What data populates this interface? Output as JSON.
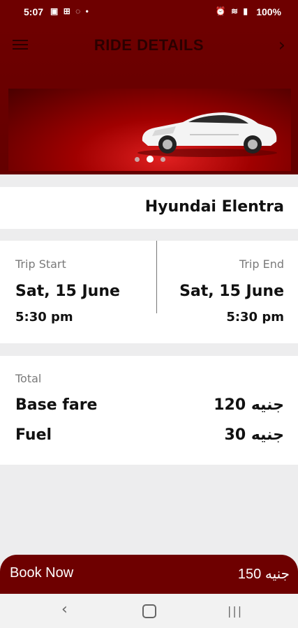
{
  "status_bar": {
    "time": "5:07",
    "left_icons": [
      "gallery-icon",
      "cart-icon",
      "whatsapp-icon"
    ],
    "right_icons": [
      "alarm-icon",
      "wifi-icon",
      "signal-icon"
    ],
    "battery": "100%"
  },
  "header": {
    "title": "RIDE DETAILS",
    "menu_icon": "hamburger-menu-icon",
    "next_icon": "chevron-right-icon"
  },
  "carousel": {
    "slide_count": 3,
    "active_index": 1
  },
  "car": {
    "name": "Hyundai Elentra"
  },
  "trip": {
    "start": {
      "label": "Trip Start",
      "date": "Sat, 15 June",
      "time": "5:30 pm"
    },
    "end": {
      "label": "Trip End",
      "date": "Sat, 15 June",
      "time": "5:30 pm"
    }
  },
  "fare": {
    "total_label": "Total",
    "items": [
      {
        "label": "Base fare",
        "value": "120 جنيه"
      },
      {
        "label": "Fuel",
        "value": "30 جنيه"
      }
    ]
  },
  "book": {
    "label": "Book Now",
    "total": "150 جنيه"
  },
  "nav": {
    "back_icon": "back-icon",
    "home_icon": "home-icon",
    "recent_icon": "recent-apps-icon"
  },
  "colors": {
    "brand": "#6e0000",
    "muted_text": "#7a7a7a",
    "background": "#ededee"
  }
}
